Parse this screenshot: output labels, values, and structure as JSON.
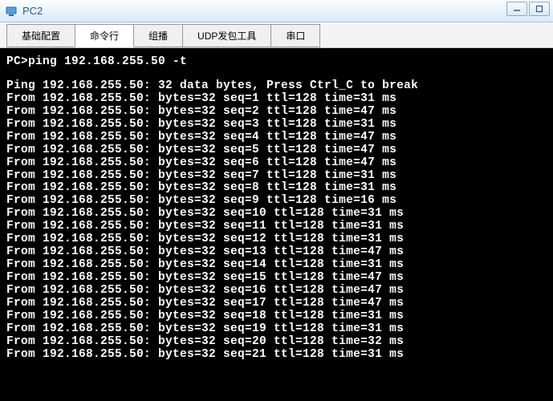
{
  "window": {
    "title": "PC2"
  },
  "tabs": {
    "items": [
      {
        "label": "基础配置"
      },
      {
        "label": "命令行"
      },
      {
        "label": "组播"
      },
      {
        "label": "UDP发包工具"
      },
      {
        "label": "串口"
      }
    ],
    "active_index": 1
  },
  "terminal": {
    "prompt_line": "PC>ping 192.168.255.50 -t",
    "header_line": "Ping 192.168.255.50: 32 data bytes, Press Ctrl_C to break",
    "replies": [
      {
        "text": "From 192.168.255.50: bytes=32 seq=1 ttl=128 time=31 ms"
      },
      {
        "text": "From 192.168.255.50: bytes=32 seq=2 ttl=128 time=47 ms"
      },
      {
        "text": "From 192.168.255.50: bytes=32 seq=3 ttl=128 time=31 ms"
      },
      {
        "text": "From 192.168.255.50: bytes=32 seq=4 ttl=128 time=47 ms"
      },
      {
        "text": "From 192.168.255.50: bytes=32 seq=5 ttl=128 time=47 ms"
      },
      {
        "text": "From 192.168.255.50: bytes=32 seq=6 ttl=128 time=47 ms"
      },
      {
        "text": "From 192.168.255.50: bytes=32 seq=7 ttl=128 time=31 ms"
      },
      {
        "text": "From 192.168.255.50: bytes=32 seq=8 ttl=128 time=31 ms"
      },
      {
        "text": "From 192.168.255.50: bytes=32 seq=9 ttl=128 time=16 ms"
      },
      {
        "text": "From 192.168.255.50: bytes=32 seq=10 ttl=128 time=31 ms"
      },
      {
        "text": "From 192.168.255.50: bytes=32 seq=11 ttl=128 time=31 ms"
      },
      {
        "text": "From 192.168.255.50: bytes=32 seq=12 ttl=128 time=31 ms"
      },
      {
        "text": "From 192.168.255.50: bytes=32 seq=13 ttl=128 time=47 ms"
      },
      {
        "text": "From 192.168.255.50: bytes=32 seq=14 ttl=128 time=31 ms"
      },
      {
        "text": "From 192.168.255.50: bytes=32 seq=15 ttl=128 time=47 ms"
      },
      {
        "text": "From 192.168.255.50: bytes=32 seq=16 ttl=128 time=47 ms"
      },
      {
        "text": "From 192.168.255.50: bytes=32 seq=17 ttl=128 time=47 ms"
      },
      {
        "text": "From 192.168.255.50: bytes=32 seq=18 ttl=128 time=31 ms"
      },
      {
        "text": "From 192.168.255.50: bytes=32 seq=19 ttl=128 time=31 ms"
      },
      {
        "text": "From 192.168.255.50: bytes=32 seq=20 ttl=128 time=32 ms"
      },
      {
        "text": "From 192.168.255.50: bytes=32 seq=21 ttl=128 time=31 ms"
      }
    ]
  }
}
